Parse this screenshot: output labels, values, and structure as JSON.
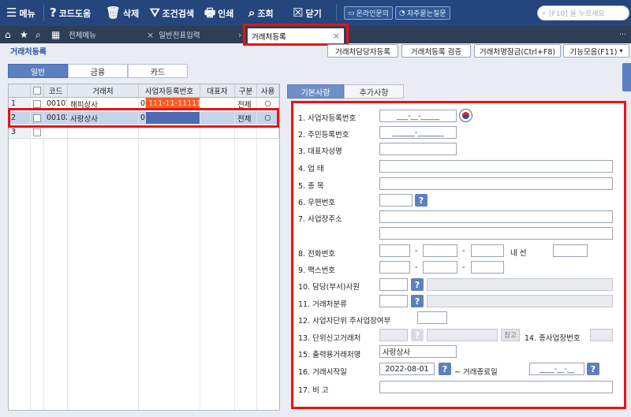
{
  "toolbar": {
    "menu": "메뉴",
    "code_help": "코드도움",
    "delete": "삭제",
    "search": "조건검색",
    "print": "인쇄",
    "view": "조회",
    "close": "닫기",
    "online_inquiry": "온라인문의",
    "faq": "자주묻는질문",
    "search_placeholder": "[F10] 을 누르세요"
  },
  "tabs": {
    "all_menu": "전체메뉴",
    "journal_input": "일반전표입력",
    "active": "거래처등록"
  },
  "header": {
    "title": "거래처등록",
    "btn_manager": "거래처담당자등록",
    "btn_verify": "거래처등록 검증",
    "btn_lock": "거래처명잠금(Ctrl+F8)",
    "btn_features": "기능모음(F11)"
  },
  "left_tabs": [
    "일반",
    "금융",
    "카드"
  ],
  "grid": {
    "columns": [
      "코드",
      "거래처",
      "사업자등록번호",
      "대표자",
      "구분",
      "사용"
    ],
    "rows": [
      {
        "num": "1",
        "code": "00101",
        "name": "해피상사",
        "bizflag": "0",
        "biznum": "111-11-11111",
        "rep": "",
        "type": "전체",
        "use": "○"
      },
      {
        "num": "2",
        "code": "00102",
        "name": "사랑상사",
        "bizflag": "0",
        "biznum": "",
        "rep": "",
        "type": "전체",
        "use": "○"
      },
      {
        "num": "3",
        "code": "",
        "name": "",
        "bizflag": "",
        "biznum": "",
        "rep": "",
        "type": "",
        "use": ""
      }
    ]
  },
  "right_tabs": [
    "기본사항",
    "추가사항"
  ],
  "form": {
    "f1": "1. 사업자등록번호",
    "f1_value": "___-__-_____",
    "f2": "2. 주민등록번호",
    "f2_value": "______-_______",
    "f3": "3. 대표자성명",
    "f4": "4. 업 태",
    "f5": "5. 종 목",
    "f6": "6. 우편번호",
    "f7": "7. 사업장주소",
    "f8": "8. 전화번호",
    "f8_ext": "내 선",
    "f9": "9. 팩스번호",
    "f10": "10. 담당(부서)사원",
    "f11": "11. 거래처분류",
    "f12": "12. 사업자단위 주사업장여부",
    "f13": "13. 단위신고거래처",
    "f13_ref": "참고",
    "f14": "14. 종사업장번호",
    "f15": "15. 출력용거래처명",
    "f15_value": "사랑상사",
    "f16": "16. 거래시작일",
    "f16_value": "2022-08-01",
    "f16_end": "~ 거래종료일",
    "f16_end_value": "____-__-__",
    "f17": "17. 비 고",
    "dash": "-"
  }
}
